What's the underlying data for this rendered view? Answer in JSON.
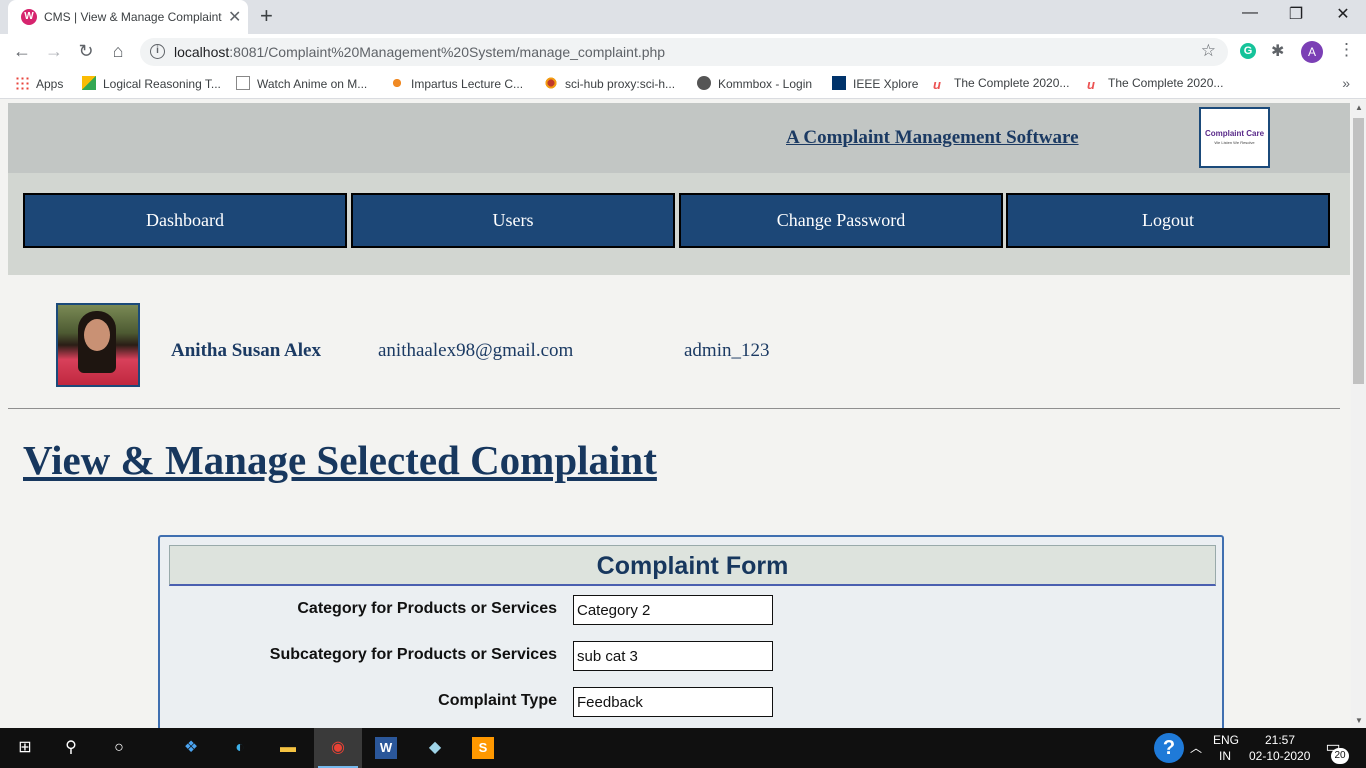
{
  "browser": {
    "tab_title": "CMS | View & Manage Complaint",
    "tab_favicon_letter": "W",
    "url_host": "localhost",
    "url_rest": ":8081/Complaint%20Management%20System/manage_complaint.php",
    "profile_initial": "A",
    "ext_g_letter": "G"
  },
  "bookmarks": [
    {
      "label": "Apps",
      "icon": "apps-grid-icon"
    },
    {
      "label": "Logical Reasoning T...",
      "icon": "drive-icon"
    },
    {
      "label": "Watch Anime on M...",
      "icon": "page-icon"
    },
    {
      "label": "Impartus Lecture C...",
      "icon": "impartus-icon"
    },
    {
      "label": "sci-hub proxy:sci-h...",
      "icon": "scihub-eye-icon"
    },
    {
      "label": "Kommbox - Login",
      "icon": "globe-icon"
    },
    {
      "label": "IEEE Xplore",
      "icon": "ieee-icon"
    },
    {
      "label": "The Complete 2020...",
      "icon": "udemy-icon"
    },
    {
      "label": "The Complete 2020...",
      "icon": "udemy-icon"
    }
  ],
  "header": {
    "tagline": "A Complaint Management Software",
    "logo_text": "Complaint Care",
    "logo_sub": "We Listen We Resolve"
  },
  "nav": {
    "dashboard": "Dashboard",
    "users": "Users",
    "change_password": "Change Password",
    "logout": "Logout"
  },
  "user": {
    "name": "Anitha Susan Alex",
    "email": "anithaalex98@gmail.com",
    "username": "admin_123"
  },
  "page": {
    "title": "View & Manage Selected Complaint"
  },
  "form": {
    "title": "Complaint Form",
    "fields": [
      {
        "label": "Category for Products or Services",
        "value": "Category 2"
      },
      {
        "label": "Subcategory for Products or Services",
        "value": "sub cat 3"
      },
      {
        "label": "Complaint Type",
        "value": "Feedback"
      }
    ]
  },
  "taskbar": {
    "lang_top": "ENG",
    "lang_bottom": "IN",
    "time": "21:57",
    "date": "02-10-2020",
    "notification_count": "20"
  }
}
